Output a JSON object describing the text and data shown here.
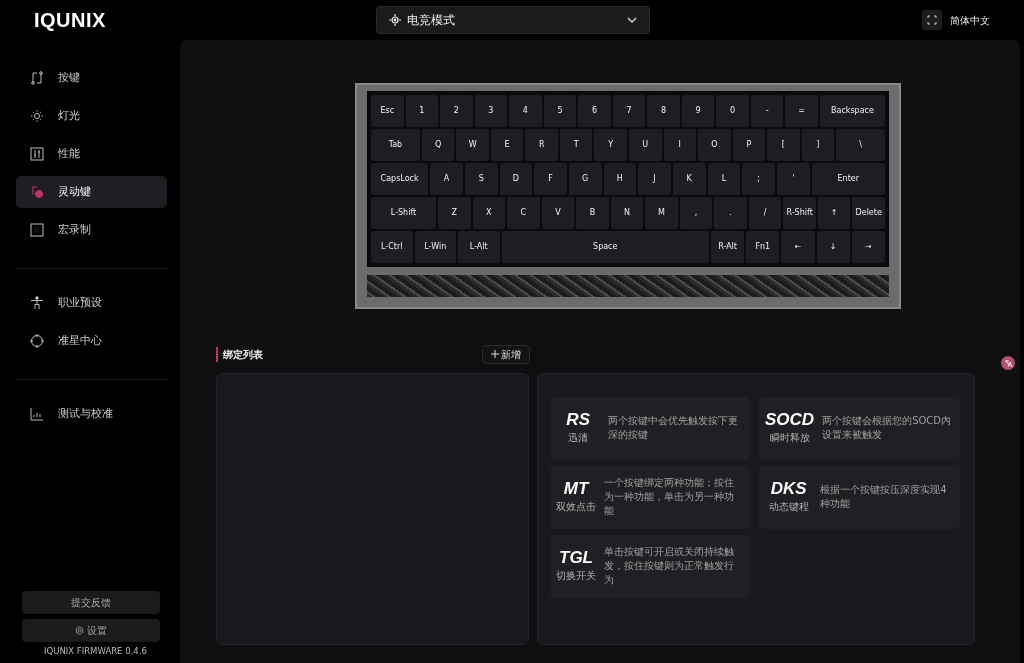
{
  "brand": "IQUNIX",
  "mode_select": {
    "value": "电竞模式"
  },
  "language": "简体中文",
  "sidebar": {
    "groups": [
      [
        {
          "label": "按键",
          "selected": false
        },
        {
          "label": "灯光",
          "selected": false
        },
        {
          "label": "性能",
          "selected": false
        },
        {
          "label": "灵动键",
          "selected": true
        },
        {
          "label": "宏录制",
          "selected": false
        }
      ],
      [
        {
          "label": "职业预设",
          "selected": false
        },
        {
          "label": "准星中心",
          "selected": false
        }
      ],
      [
        {
          "label": "测试与校准",
          "selected": false
        }
      ]
    ],
    "feedback_button": "提交反馈",
    "settings_button": "设置",
    "firmware": "IQUNIX FIRMWARE 0.4.6"
  },
  "keyboard": {
    "rows": [
      {
        "keys": [
          "Esc",
          "1",
          "2",
          "3",
          "4",
          "5",
          "6",
          "7",
          "8",
          "9",
          "0",
          "-",
          "=",
          "Backspace"
        ]
      },
      {
        "keys": [
          "Tab",
          "Q",
          "W",
          "E",
          "R",
          "T",
          "Y",
          "U",
          "I",
          "O",
          "P",
          "[",
          "]",
          "\\"
        ]
      },
      {
        "keys": [
          "CapsLock",
          "A",
          "S",
          "D",
          "F",
          "G",
          "H",
          "J",
          "K",
          "L",
          ";",
          "'",
          "Enter"
        ]
      },
      {
        "keys": [
          "L-Shift",
          "Z",
          "X",
          "C",
          "V",
          "B",
          "N",
          "M",
          ",",
          ".",
          "/",
          "R-Shift",
          "↑",
          "Delete"
        ]
      },
      {
        "keys": [
          "L-Ctrl",
          "L-Win",
          "L-Alt",
          "Space",
          "R-Alt",
          "Fn1",
          "←",
          "↓",
          "→"
        ]
      }
    ]
  },
  "binding_list": {
    "title": "绑定列表",
    "add_button": "新增"
  },
  "functions": [
    {
      "code": "RS",
      "name": "迅清",
      "description": "两个按键中会优先触发按下更深的按键"
    },
    {
      "code": "SOCD",
      "name": "瞬时释放",
      "description": "两个按键会根据您的SOCD内设置来被触发"
    },
    {
      "code": "MT",
      "name": "双效点击",
      "description": "一个按键绑定两种功能；按住为一种功能，单击为另一种功能"
    },
    {
      "code": "DKS",
      "name": "动态键程",
      "description": "根据一个按键按压深度实现4种功能"
    },
    {
      "code": "TGL",
      "name": "切换开关",
      "description": "单击按键可开启或关闭持续触发，按住按键则为正常触发行为"
    }
  ]
}
